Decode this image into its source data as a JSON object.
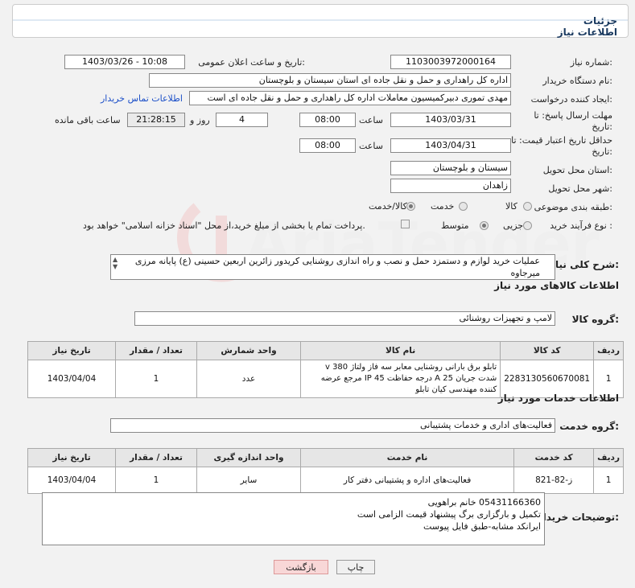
{
  "header": {
    "title": "جزئیات اطلاعات نیاز"
  },
  "form": {
    "need_number_label": "شماره نیاز:",
    "need_number": "1103003972000164",
    "announce_label": "تاریخ و ساعت اعلان عمومی:",
    "announce_value": "1403/03/26 - 10:08",
    "buyer_org_label": "نام دستگاه خریدار:",
    "buyer_org": "اداره کل راهداری و حمل و نقل جاده ای استان سیستان و بلوچستان",
    "creator_label": "ایجاد کننده درخواست:",
    "creator": "مهدی تموری دبیرکمیسیون معاملات اداره کل راهداری و حمل و نقل جاده ای است",
    "contact_link": "اطلاعات تماس خریدار",
    "deadline_label": "مهلت ارسال پاسخ: تا تاریخ:",
    "deadline_date": "1403/03/31",
    "time_label": "ساعت",
    "deadline_time": "08:00",
    "days_value": "4",
    "days_label": "روز و",
    "remaining_time": "21:28:15",
    "remaining_label": "ساعت باقی مانده",
    "validity_label": "حداقل تاریخ اعتبار قیمت: تا تاریخ:",
    "validity_date": "1403/04/31",
    "validity_time": "08:00",
    "province_label": "استان محل تحویل:",
    "province": "سیستان و بلوچستان",
    "city_label": "شهر محل تحویل:",
    "city": "زاهدان",
    "category_label": "طبقه بندی موضوعی:",
    "category_options": [
      "کالا",
      "خدمت",
      "کالا/خدمت"
    ],
    "process_label": "نوع فرآیند خرید :",
    "process_options": [
      "جزیی",
      "متوسط"
    ],
    "payment_note": "پرداخت تمام یا بخشی از مبلغ خرید،از محل \"اسناد خزانه اسلامی\" خواهد بود."
  },
  "description": {
    "label": "شرح کلی نیاز:",
    "text": "عملیات خرید لوازم و دستمزد حمل و نصب و راه اندازی روشنایی کریدور زائرین اربعین حسینی (ع) پایانه مرزی میرجاوه"
  },
  "goods": {
    "section_title": "اطلاعات کالاهای مورد نیاز",
    "group_label": "گروه کالا:",
    "group_value": "لامپ و تجهیزات روشنائی",
    "headers": [
      "ردیف",
      "کد کالا",
      "نام کالا",
      "واحد شمارش",
      "تعداد / مقدار",
      "تاریخ نیاز"
    ],
    "rows": [
      {
        "index": "1",
        "code": "2283130560670081",
        "name": "تابلو برق بارانی روشنایی معابر سه فاز ولتاژ 380 v شدت جریان 25 A درجه حفاظت IP 45 مرجع عرضه کننده مهندسی کیان تابلو",
        "unit": "عدد",
        "qty": "1",
        "date": "1403/04/04"
      }
    ]
  },
  "services": {
    "section_title": "اطلاعات خدمات مورد نیاز",
    "group_label": "گروه خدمت:",
    "group_value": "فعالیت‌های اداری و خدمات پشتیبانی",
    "headers": [
      "ردیف",
      "کد خدمت",
      "نام خدمت",
      "واحد اندازه گیری",
      "تعداد / مقدار",
      "تاریخ نیاز"
    ],
    "rows": [
      {
        "index": "1",
        "code": "ز-82-821",
        "name": "فعالیت‌های اداره و پشتیبانی دفتر کار",
        "unit": "سایر",
        "qty": "1",
        "date": "1403/04/04"
      }
    ]
  },
  "buyer_notes": {
    "label": "توضیحات خریدار:",
    "lines": [
      "05431166360 خانم براهویی",
      "تکمیل و بارگزاری برگ پیشنهاد قیمت الزامی است",
      "ایرانکد مشابه-طبق فایل پیوست"
    ]
  },
  "buttons": {
    "print": "چاپ",
    "back": "بازگشت"
  },
  "colors": {
    "title": "#1a3a60",
    "link": "#1a4ec8",
    "back_button_bg": "#f8d7d7"
  }
}
